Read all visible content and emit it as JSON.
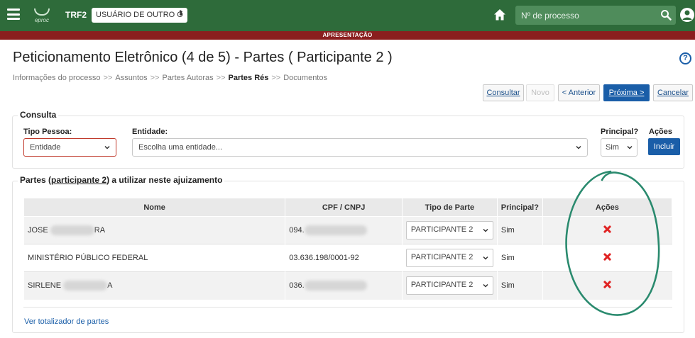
{
  "header": {
    "logo_text": "eproc",
    "org": "TRF2",
    "user_select_value": "USUÁRIO DE OUTRO Ó",
    "search_placeholder": "Nº de processo",
    "environment_banner": "APRESENTAÇÃO",
    "colors": {
      "topbar": "#2e6b3a",
      "banner": "#8a1e1e",
      "primary": "#1a5ea8",
      "delete": "#e02424"
    }
  },
  "page": {
    "title": "Peticionamento Eletrônico (4 de 5) - Partes ( Participante 2 )",
    "help": "?"
  },
  "breadcrumb": {
    "items": [
      "Informações do processo",
      "Assuntos",
      "Partes Autoras",
      "Partes Rés",
      "Documentos"
    ],
    "separator": ">>",
    "current_index": 3
  },
  "actions": {
    "consultar": "Consultar",
    "novo": "Novo",
    "anterior": "< Anterior",
    "proxima": "Próxima >",
    "cancelar": "Cancelar"
  },
  "consulta": {
    "legend": "Consulta",
    "tipo_pessoa_label": "Tipo Pessoa:",
    "tipo_pessoa_value": "Entidade",
    "entidade_label": "Entidade:",
    "entidade_placeholder": "Escolha uma entidade...",
    "principal_label": "Principal?",
    "principal_value": "Sim",
    "acoes_label": "Ações",
    "incluir": "Incluir"
  },
  "partes": {
    "legend_prefix": "Partes (",
    "legend_link": "participante 2",
    "legend_suffix": ") a utilizar neste ajuizamento",
    "columns": [
      "Nome",
      "CPF / CNPJ",
      "Tipo de Parte",
      "Principal?",
      "Ações"
    ],
    "rows": [
      {
        "nome_prefix": "JOSE ",
        "nome_suffix": "RA",
        "cpf_prefix": "094.",
        "tipo": "PARTICIPANTE 2",
        "principal": "Sim"
      },
      {
        "nome_prefix": "MINISTÉRIO PÚBLICO FEDERAL",
        "nome_suffix": "",
        "cpf_prefix": "03.636.198/0001-92",
        "tipo": "PARTICIPANTE 2",
        "principal": "Sim"
      },
      {
        "nome_prefix": "SIRLENE ",
        "nome_suffix": "A",
        "cpf_prefix": "036.",
        "tipo": "PARTICIPANTE 2",
        "principal": "Sim"
      }
    ],
    "totalizador_link": "Ver totalizador de partes"
  }
}
